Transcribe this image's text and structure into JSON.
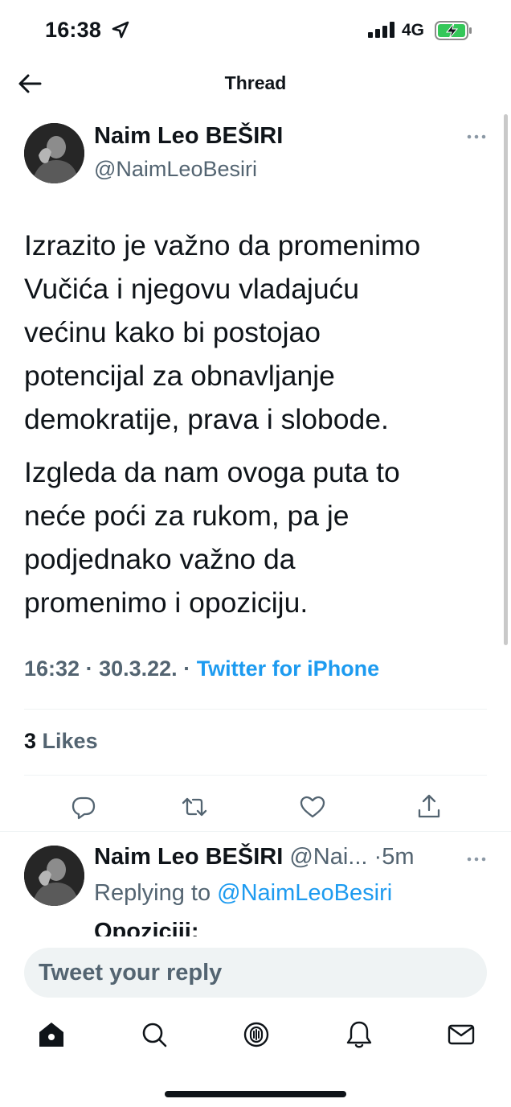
{
  "status_bar": {
    "time": "16:38",
    "network": "4G"
  },
  "header": {
    "title": "Thread"
  },
  "tweet": {
    "author_name": "Naim Leo BEŠIRI",
    "handle": "@NaimLeoBesiri",
    "paragraphs": [
      "Izrazito je važno da promenimo\nVučića i njegovu vladajuću\nvećinu kako bi postojao\npotencijal za obnavljanje\ndemokratije, prava i slobode.",
      "Izgleda da nam ovoga puta to\nneće poći za rukom, pa je\npodjednako važno da\npromenimo i opoziciju."
    ],
    "time": "16:32",
    "date": "30.3.22.",
    "source": "Twitter for iPhone",
    "likes_count": "3",
    "likes_label": "Likes"
  },
  "reply": {
    "author_name": "Naim Leo BEŠIRI",
    "handle": "@Nai...",
    "time": "5m",
    "replying_label": "Replying to",
    "replying_to": "@NaimLeoBesiri",
    "snippet": "Opoziciji:"
  },
  "compose": {
    "placeholder": "Tweet your reply"
  },
  "colors": {
    "accent": "#1d9bf0",
    "text": "#0f1419",
    "secondary": "#536471",
    "divider": "#eff3f4"
  },
  "icons": {
    "actions": [
      "reply-icon",
      "retweet-icon",
      "like-icon",
      "share-icon"
    ],
    "tabs": [
      "home-icon",
      "search-icon",
      "spaces-icon",
      "notifications-icon",
      "messages-icon"
    ]
  }
}
